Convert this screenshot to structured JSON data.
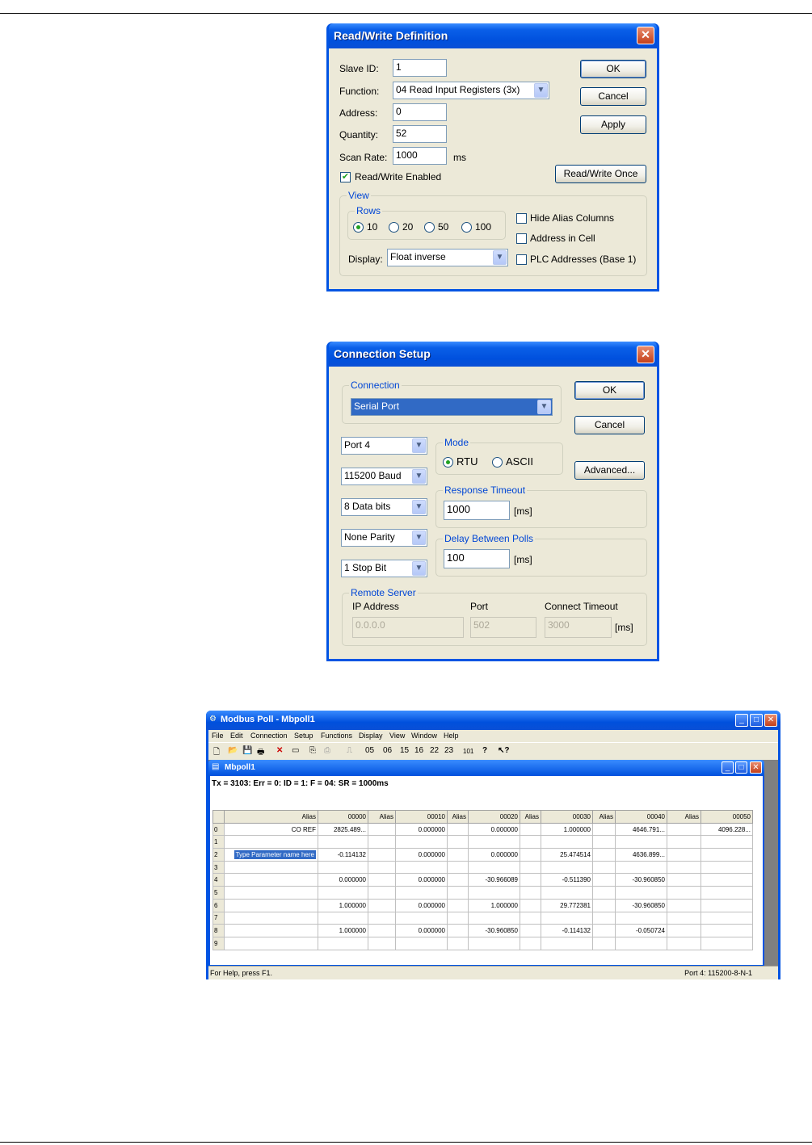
{
  "rw": {
    "title": "Read/Write Definition",
    "slave_id_label": "Slave ID:",
    "slave_id": "1",
    "function_label": "Function:",
    "function": "04 Read Input Registers (3x)",
    "address_label": "Address:",
    "address": "0",
    "quantity_label": "Quantity:",
    "quantity": "52",
    "scan_rate_label": "Scan Rate:",
    "scan_rate": "1000",
    "scan_unit": "ms",
    "enabled_label": "Read/Write Enabled",
    "enabled": true,
    "ok": "OK",
    "cancel": "Cancel",
    "apply": "Apply",
    "once": "Read/Write Once",
    "view_group": "View",
    "rows_group": "Rows",
    "rows_options": [
      "10",
      "20",
      "50",
      "100"
    ],
    "rows_selected": "10",
    "hide_alias": "Hide Alias Columns",
    "address_in_cell": "Address in Cell",
    "plc_addresses": "PLC Addresses (Base 1)",
    "display_label": "Display:",
    "display": "Float inverse"
  },
  "conn": {
    "title": "Connection Setup",
    "connection_group": "Connection",
    "connection": "Serial Port",
    "ok": "OK",
    "cancel": "Cancel",
    "advanced": "Advanced...",
    "port": "Port 4",
    "baud": "115200 Baud",
    "data_bits": "8 Data bits",
    "parity": "None Parity",
    "stop_bits": "1 Stop Bit",
    "mode_group": "Mode",
    "mode_rtu": "RTU",
    "mode_ascii": "ASCII",
    "response_group": "Response Timeout",
    "response_timeout": "1000",
    "ms": "[ms]",
    "delay_group": "Delay Between Polls",
    "delay": "100",
    "remote_group": "Remote Server",
    "ip_label": "IP Address",
    "ip": "0.0.0.0",
    "port_label": "Port",
    "remote_port": "502",
    "timeout_label": "Connect Timeout",
    "connect_timeout": "3000"
  },
  "mbpoll": {
    "title": "Modbus Poll - Mbpoll1",
    "menu": [
      "File",
      "Edit",
      "Connection",
      "Setup",
      "Functions",
      "Display",
      "View",
      "Window",
      "Help"
    ],
    "toolbar_codes": [
      "05",
      "06",
      "15",
      "16",
      "22",
      "23",
      "101"
    ],
    "child_title": "Mbpoll1",
    "header_line": "Tx = 3103: Err = 0: ID = 1: F = 04: SR = 1000ms",
    "columns": [
      "Alias",
      "00000",
      "Alias",
      "00010",
      "Alias",
      "00020",
      "Alias",
      "00030",
      "Alias",
      "00040",
      "Alias",
      "00050"
    ],
    "rows": [
      [
        "0",
        "CO REF",
        "2825.489...",
        "",
        "0.000000",
        "",
        "0.000000",
        "",
        "1.000000",
        "",
        "4646.791...",
        "",
        "4096.228..."
      ],
      [
        "1",
        "",
        "",
        "",
        "",
        "",
        "",
        "",
        "",
        "",
        "",
        "",
        ""
      ],
      [
        "2",
        "Type Parameter name here",
        "-0.114132",
        "",
        "0.000000",
        "",
        "0.000000",
        "",
        "25.474514",
        "",
        "4636.899...",
        "",
        ""
      ],
      [
        "3",
        "",
        "",
        "",
        "",
        "",
        "",
        "",
        "",
        "",
        "",
        "",
        ""
      ],
      [
        "4",
        "",
        "0.000000",
        "",
        "0.000000",
        "",
        "-30.966089",
        "",
        "-0.511390",
        "",
        "-30.960850",
        "",
        ""
      ],
      [
        "5",
        "",
        "",
        "",
        "",
        "",
        "",
        "",
        "",
        "",
        "",
        "",
        ""
      ],
      [
        "6",
        "",
        "1.000000",
        "",
        "0.000000",
        "",
        "1.000000",
        "",
        "29.772381",
        "",
        "-30.960850",
        "",
        ""
      ],
      [
        "7",
        "",
        "",
        "",
        "",
        "",
        "",
        "",
        "",
        "",
        "",
        "",
        ""
      ],
      [
        "8",
        "",
        "1.000000",
        "",
        "0.000000",
        "",
        "-30.960850",
        "",
        "-0.114132",
        "",
        "-0.050724",
        "",
        ""
      ],
      [
        "9",
        "",
        "",
        "",
        "",
        "",
        "",
        "",
        "",
        "",
        "",
        "",
        ""
      ]
    ],
    "status_left": "For Help, press F1.",
    "status_right": "Port 4: 115200-8-N-1"
  }
}
